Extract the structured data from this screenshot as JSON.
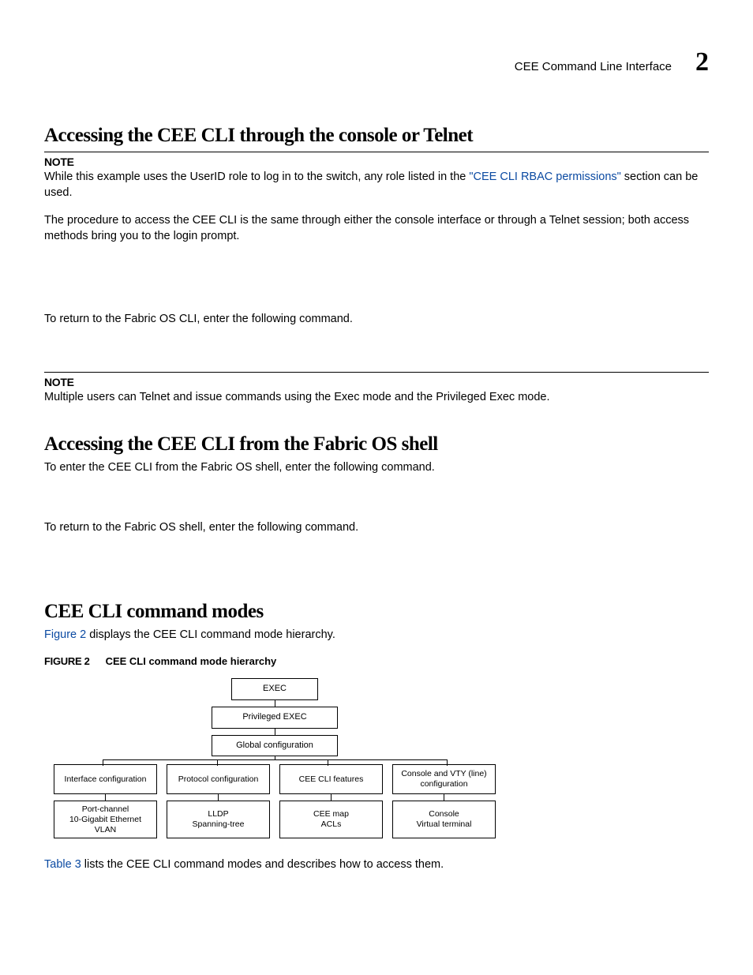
{
  "header": {
    "running": "CEE Command Line Interface",
    "chapter": "2"
  },
  "s1": {
    "title": "Accessing the CEE CLI through the console or Telnet",
    "note_label": "NOTE",
    "note_a": "While this example uses the UserID role to log in to the switch, any role listed in the ",
    "note_link": "\"CEE CLI RBAC permissions\"",
    "note_b": " section can be used.",
    "p1": "The procedure to access the CEE CLI is the same through either the console interface or through a Telnet session; both access methods bring you to the login prompt.",
    "p2": "To return to the Fabric OS CLI, enter the following command.",
    "note2_label": "NOTE",
    "note2": "Multiple users can Telnet and issue commands using the Exec mode and the Privileged Exec mode."
  },
  "s2": {
    "title": "Accessing the CEE CLI from the Fabric OS shell",
    "p1": "To enter the CEE CLI from the Fabric OS shell, enter the following command.",
    "p2": "To return to the Fabric OS shell, enter the following command."
  },
  "s3": {
    "title": "CEE CLI command modes",
    "p1a": "Figure 2",
    "p1b": " displays the CEE CLI command mode hierarchy.",
    "fig_label": "FIGURE 2",
    "fig_title": "CEE CLI command mode hierarchy",
    "p2a": "Table 3",
    "p2b": " lists the CEE CLI command modes and describes how to access them."
  },
  "diagram": {
    "r1": "EXEC",
    "r2": "Privileged EXEC",
    "r3": "Global configuration",
    "r4": [
      "Interface configuration",
      "Protocol configuration",
      "CEE CLI features",
      "Console and VTY (line) configuration"
    ],
    "r5": [
      "Port-channel\n10-Gigabit Ethernet\nVLAN",
      "LLDP\nSpanning-tree",
      "CEE map\nACLs",
      "Console\nVirtual terminal"
    ]
  }
}
